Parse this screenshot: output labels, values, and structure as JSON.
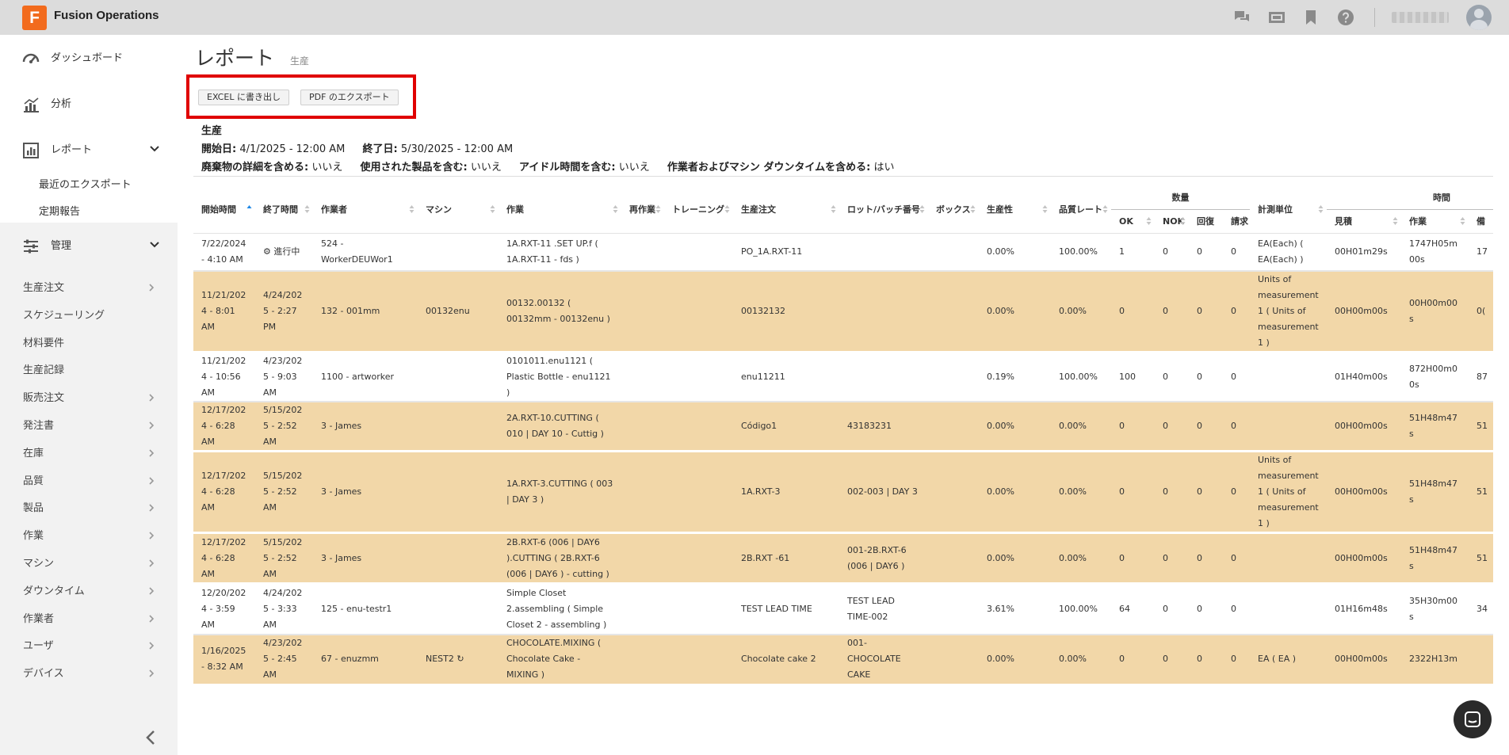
{
  "app": {
    "logo_letter": "F",
    "title": "Fusion Operations"
  },
  "sidebar": {
    "top_items": [
      {
        "label": "ダッシュボード",
        "icon": "gauge-icon"
      },
      {
        "label": "分析",
        "icon": "bar-chart-icon"
      },
      {
        "label": "レポート",
        "icon": "report-icon"
      }
    ],
    "report_sub": [
      "最近のエクスポート",
      "定期報告"
    ],
    "admin": {
      "label": "管理",
      "icon": "sliders-icon"
    },
    "items": [
      "生産注文",
      "スケジューリング",
      "材料要件",
      "生産記録",
      "販売注文",
      "発注書",
      "在庫",
      "品質",
      "製品",
      "作業",
      "マシン",
      "ダウンタイム",
      "作業者",
      "ユーザ",
      "デバイス"
    ]
  },
  "page": {
    "title": "レポート",
    "subtitle": "生産",
    "buttons": {
      "excel": "EXCEL に書き出し",
      "pdf": "PDF のエクスポート"
    },
    "report_name": "生産",
    "start_label": "開始日:",
    "start_value": "4/1/2025 - 12:00 AM",
    "end_label": "終了日:",
    "end_value": "5/30/2025 - 12:00 AM",
    "opt1_label": "廃棄物の詳細を含める:",
    "opt1_value": "いいえ",
    "opt2_label": "使用された製品を含む:",
    "opt2_value": "いいえ",
    "opt3_label": "アイドル時間を含む:",
    "opt3_value": "いいえ",
    "opt4_label": "作業者およびマシン ダウンタイムを含める:",
    "opt4_value": "はい"
  },
  "table": {
    "group_headers": {
      "quantity": "数量",
      "time": "時間"
    },
    "headers": [
      "開始時間",
      "終了時間",
      "作業者",
      "マシン",
      "作業",
      "再作業",
      "トレーニング",
      "生産注文",
      "ロット/バッチ番号",
      "ボックス",
      "生産性",
      "品質レート",
      "OK",
      "NOK",
      "回復",
      "請求",
      "計測単位",
      "見積",
      "作業",
      "備"
    ],
    "in_progress_label": "進行中",
    "rows": [
      {
        "style": "white",
        "start": "7/22/2024 - 4:10 AM",
        "end": "",
        "in_progress": true,
        "operator": "524 - WorkerDEUWor1",
        "machine": "",
        "machine_refresh": false,
        "operation": "1A.RXT-11 .SET UP.f ( 1A.RXT-11 - fds )",
        "rework": "",
        "training": "",
        "order": "PO_1A.RXT-11",
        "lot": "",
        "box": "",
        "productivity": "0.00%",
        "quality": "100.00%",
        "ok": "1",
        "nok": "0",
        "recovered": "0",
        "claimed": "0",
        "unit": "EA(Each) ( EA(Each) )",
        "estimate": "00H01m29s",
        "work": "1747H05m00s",
        "extra": "17"
      },
      {
        "style": "tan",
        "start": "11/21/2024 - 8:01 AM",
        "end": "4/24/2025 - 2:27 PM",
        "in_progress": false,
        "operator": "132 - 001mm",
        "machine": "00132enu",
        "machine_refresh": false,
        "operation": "00132.00132 ( 00132mm - 00132enu )",
        "rework": "",
        "training": "",
        "order": "00132132",
        "lot": "",
        "box": "",
        "productivity": "0.00%",
        "quality": "0.00%",
        "ok": "0",
        "nok": "0",
        "recovered": "0",
        "claimed": "0",
        "unit": "Units of measurement1 ( Units of measurement1 )",
        "estimate": "00H00m00s",
        "work": "00H00m00s",
        "extra": "0("
      },
      {
        "style": "white",
        "start": "11/21/2024 - 10:56 AM",
        "end": "4/23/2025 - 9:03 AM",
        "in_progress": false,
        "operator": "1100 - artworker",
        "machine": "",
        "machine_refresh": false,
        "operation": "0101011.enu1121 ( Plastic Bottle - enu1121 )",
        "rework": "",
        "training": "",
        "order": "enu11211",
        "lot": "",
        "box": "",
        "productivity": "0.19%",
        "quality": "100.00%",
        "ok": "100",
        "nok": "0",
        "recovered": "0",
        "claimed": "0",
        "unit": "",
        "estimate": "01H40m00s",
        "work": "872H00m00s",
        "extra": "87"
      },
      {
        "style": "tan",
        "start": "12/17/2024 - 6:28 AM",
        "end": "5/15/2025 - 2:52 AM",
        "in_progress": false,
        "operator": "3 - James",
        "machine": "",
        "machine_refresh": false,
        "operation": "2A.RXT-10.CUTTING ( 010 | DAY 10 - Cuttig )",
        "rework": "",
        "training": "",
        "order": "Código1",
        "lot": "43183231",
        "box": "",
        "productivity": "0.00%",
        "quality": "0.00%",
        "ok": "0",
        "nok": "0",
        "recovered": "0",
        "claimed": "0",
        "unit": "",
        "estimate": "00H00m00s",
        "work": "51H48m47s",
        "extra": "51"
      },
      {
        "style": "tan",
        "start": "12/17/2024 - 6:28 AM",
        "end": "5/15/2025 - 2:52 AM",
        "in_progress": false,
        "operator": "3 - James",
        "machine": "",
        "machine_refresh": false,
        "operation": "1A.RXT-3.CUTTING ( 003 | DAY 3 )",
        "rework": "",
        "training": "",
        "order": "1A.RXT-3",
        "lot": "002-003 | DAY 3",
        "box": "",
        "productivity": "0.00%",
        "quality": "0.00%",
        "ok": "0",
        "nok": "0",
        "recovered": "0",
        "claimed": "0",
        "unit": "Units of measurement1 ( Units of measurement1 )",
        "estimate": "00H00m00s",
        "work": "51H48m47s",
        "extra": "51"
      },
      {
        "style": "tan",
        "start": "12/17/2024 - 6:28 AM",
        "end": "5/15/2025 - 2:52 AM",
        "in_progress": false,
        "operator": "3 - James",
        "machine": "",
        "machine_refresh": false,
        "operation": "2B.RXT-6 (006 | DAY6 ).CUTTING ( 2B.RXT-6 (006 | DAY6 ) - cutting )",
        "rework": "",
        "training": "",
        "order": "2B.RXT -61",
        "lot": "001-2B.RXT-6 (006 | DAY6 )",
        "box": "",
        "productivity": "0.00%",
        "quality": "0.00%",
        "ok": "0",
        "nok": "0",
        "recovered": "0",
        "claimed": "0",
        "unit": "",
        "estimate": "00H00m00s",
        "work": "51H48m47s",
        "extra": "51"
      },
      {
        "style": "white",
        "start": "12/20/2024 - 3:59 AM",
        "end": "4/24/2025 - 3:33 AM",
        "in_progress": false,
        "operator": "125 - enu-testr1",
        "machine": "",
        "machine_refresh": false,
        "operation": "Simple Closet 2.assembling ( Simple Closet 2 - assembling )",
        "rework": "",
        "training": "",
        "order": "TEST LEAD TIME",
        "lot": "TEST LEAD TIME-002",
        "box": "",
        "productivity": "3.61%",
        "quality": "100.00%",
        "ok": "64",
        "nok": "0",
        "recovered": "0",
        "claimed": "0",
        "unit": "",
        "estimate": "01H16m48s",
        "work": "35H30m00s",
        "extra": "34"
      },
      {
        "style": "tan",
        "start": "1/16/2025 - 8:32 AM",
        "end": "4/23/2025 - 2:45 AM",
        "in_progress": false,
        "operator": "67 - enuzmm",
        "machine": "NEST2",
        "machine_refresh": true,
        "operation": "CHOCOLATE.MIXING ( Chocolate Cake - MIXING )",
        "rework": "",
        "training": "",
        "order": "Chocolate cake 2",
        "lot": "001-CHOCOLATE CAKE",
        "box": "",
        "productivity": "0.00%",
        "quality": "0.00%",
        "ok": "0",
        "nok": "0",
        "recovered": "0",
        "claimed": "0",
        "unit": "EA ( EA )",
        "estimate": "00H00m00s",
        "work": "2322H13m",
        "extra": ""
      }
    ]
  },
  "colors": {
    "accent": "#f26b1d",
    "highlight_row": "#f2d7a8",
    "highlight_box": "#e00000",
    "sort_active": "#1e88e5"
  }
}
